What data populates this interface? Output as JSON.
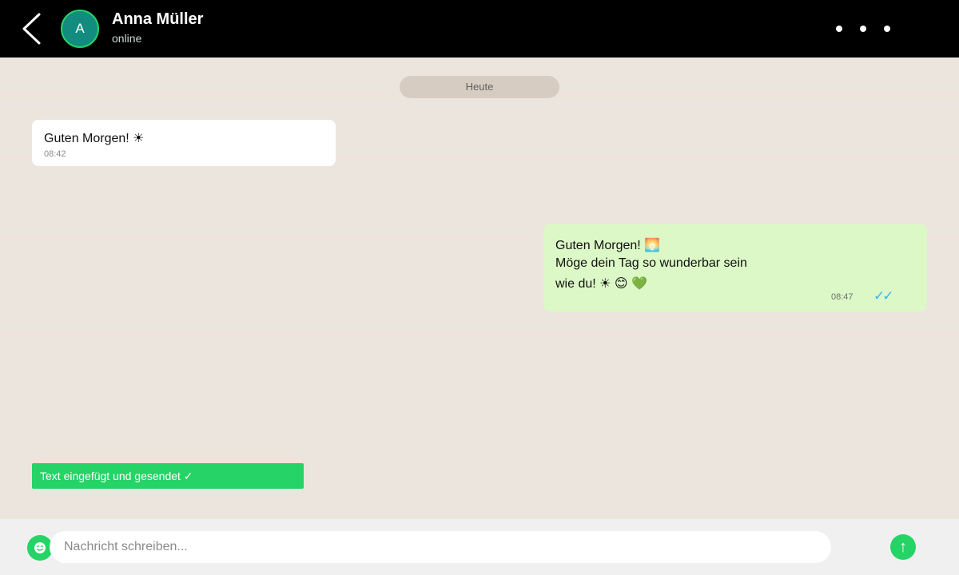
{
  "header": {
    "back_icon": "chevron-left-icon",
    "avatar_initial": "A",
    "contact_name": "Anna Müller",
    "contact_status": "online",
    "menu_icon": "more-horizontal-icon"
  },
  "chat": {
    "date_divider": "Heute",
    "messages": [
      {
        "direction": "incoming",
        "lines": [
          "Guten Morgen! ☀"
        ],
        "time": "08:42"
      },
      {
        "direction": "outgoing",
        "lines": [
          "Guten Morgen! 🌅",
          "Möge dein Tag so wunderbar sein",
          "wie du! ☀ 😊 💚"
        ],
        "time": "08:47",
        "status": "✓✓"
      }
    ]
  },
  "toast": {
    "text": "Text eingefügt und gesendet ✓"
  },
  "composer": {
    "emoji_icon": "emoji-icon",
    "placeholder": "Nachricht schreiben...",
    "value": "",
    "send_label": "↑"
  },
  "colors": {
    "header_bg": "#000000",
    "chat_bg": "#ece5de",
    "incoming_bubble": "#ffffff",
    "outgoing_bubble": "#dcf8c6",
    "accent": "#25d366",
    "avatar_bg": "#128c7e",
    "read_ticks": "#34b7f1",
    "composer_bg": "#f0f0f0"
  }
}
